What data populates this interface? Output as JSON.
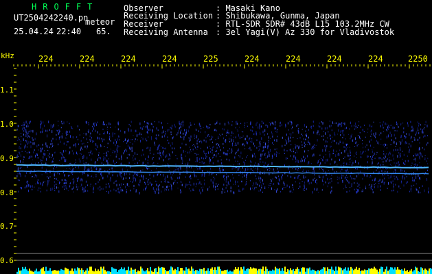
{
  "header": {
    "brand": "HROFFT",
    "filename": "UT2504242240.pn",
    "meteor_label": "meteor",
    "date": "25.04.24",
    "time": "22:40",
    "count": "65.",
    "fields": [
      {
        "label": "Observer",
        "value": ": Masaki Kano"
      },
      {
        "label": "Receiving Location",
        "value": ": Shibukawa, Gunma, Japan"
      },
      {
        "label": "Receiver",
        "value": ": RTL-SDR SDR# 43dB L15 103.2MHz CW"
      },
      {
        "label": "Receiving Antenna",
        "value": ": 3el Yagi(V) Az 330 for Vladivostok"
      }
    ]
  },
  "axis": {
    "unit": "kHz",
    "x_ticks": [
      "224",
      "224",
      "224",
      "224",
      "225",
      "224",
      "224",
      "224",
      "224",
      "2250"
    ],
    "y_ticks": [
      "1.1",
      "1.0",
      "0.9",
      "0.8",
      "0.7",
      "0.6"
    ]
  },
  "colors": {
    "brand": "#00ff55",
    "axis_text": "#ffff00",
    "signal": "#33aaff",
    "noise": "#1a2aa8"
  }
}
